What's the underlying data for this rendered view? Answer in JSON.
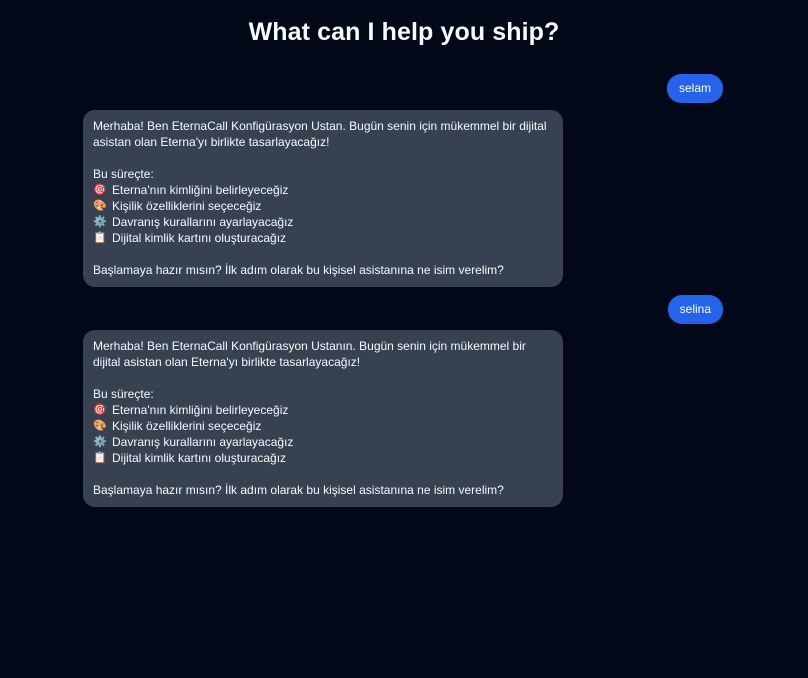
{
  "header": {
    "title": "What can I help you ship?"
  },
  "messages": [
    {
      "role": "user",
      "text": "selam"
    },
    {
      "role": "assistant",
      "intro": "Merhaba! Ben EternaCall Konfigürasyon Ustan. Bugün senin için mükemmel bir dijital asistan olan Eterna'yı birlikte tasarlayacağız!",
      "process_heading": "Bu süreçte:",
      "steps": [
        {
          "icon": "🎯",
          "icon_name": "target-icon",
          "text": "Eterna'nın kimliğini belirleyeceğiz"
        },
        {
          "icon": "🎨",
          "icon_name": "palette-icon",
          "text": "Kişilik özelliklerini seçeceğiz"
        },
        {
          "icon": "⚙️",
          "icon_name": "gear-icon",
          "text": "Davranış kurallarını ayarlayacağız"
        },
        {
          "icon": "📋",
          "icon_name": "clipboard-icon",
          "text": "Dijital kimlik kartını oluşturacağız"
        }
      ],
      "question": "Başlamaya hazır mısın? İlk adım olarak bu kişisel asistanına ne isim verelim?"
    },
    {
      "role": "user",
      "text": "selina"
    },
    {
      "role": "assistant",
      "intro": "Merhaba! Ben EternaCall Konfigürasyon Ustanın. Bugün senin için mükemmel bir dijital asistan olan Eterna'yı birlikte tasarlayacağız!",
      "process_heading": "Bu süreçte:",
      "steps": [
        {
          "icon": "🎯",
          "icon_name": "target-icon",
          "text": "Eterna'nın kimliğini belirleyeceğiz"
        },
        {
          "icon": "🎨",
          "icon_name": "palette-icon",
          "text": "Kişilik özelliklerini seçeceğiz"
        },
        {
          "icon": "⚙️",
          "icon_name": "gear-icon",
          "text": "Davranış kurallarını ayarlayacağız"
        },
        {
          "icon": "📋",
          "icon_name": "clipboard-icon",
          "text": "Dijital kimlik kartını oluşturacağız"
        }
      ],
      "question": "Başlamaya hazır mısın? İlk adım olarak bu kişisel asistanına ne isim verelim?"
    }
  ],
  "colors": {
    "background": "#020817",
    "user_bubble": "#2563eb",
    "assistant_bubble": "#374151",
    "text": "#f9fafb"
  }
}
